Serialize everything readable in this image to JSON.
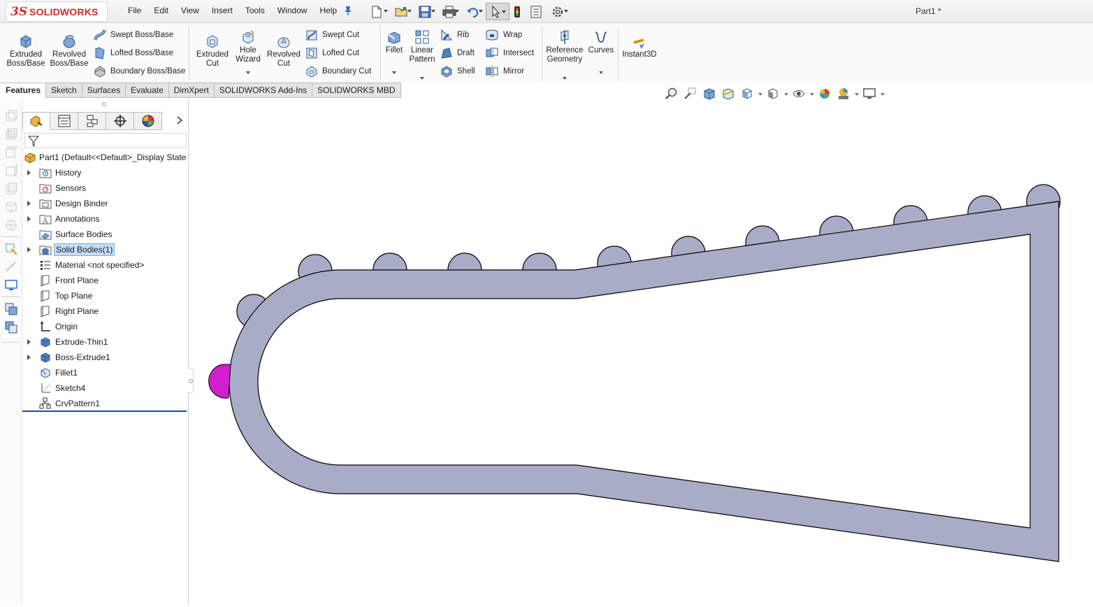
{
  "app": {
    "brand_prefix": "3S",
    "brand_name": "SOLIDWORKS",
    "document_title": "Part1 *"
  },
  "menubar": [
    "File",
    "Edit",
    "View",
    "Insert",
    "Tools",
    "Window",
    "Help"
  ],
  "quick_access": [
    "new-document",
    "open",
    "save",
    "print",
    "undo",
    "select",
    "rebuild",
    "file-properties",
    "options"
  ],
  "ribbon": {
    "extruded_boss": "Extruded\nBoss/Base",
    "revolved_boss": "Revolved\nBoss/Base",
    "swept_boss": "Swept Boss/Base",
    "lofted_boss": "Lofted Boss/Base",
    "boundary_boss": "Boundary Boss/Base",
    "extruded_cut": "Extruded\nCut",
    "hole_wizard": "Hole\nWizard",
    "revolved_cut": "Revolved\nCut",
    "swept_cut": "Swept Cut",
    "lofted_cut": "Lofted Cut",
    "boundary_cut": "Boundary Cut",
    "fillet": "Fillet",
    "linear_pattern": "Linear\nPattern",
    "rib": "Rib",
    "draft": "Draft",
    "shell": "Shell",
    "wrap": "Wrap",
    "intersect": "Intersect",
    "mirror": "Mirror",
    "reference_geometry": "Reference\nGeometry",
    "curves": "Curves",
    "instant3d": "Instant3D"
  },
  "tabs": [
    "Features",
    "Sketch",
    "Surfaces",
    "Evaluate",
    "DimXpert",
    "SOLIDWORKS Add-Ins",
    "SOLIDWORKS MBD"
  ],
  "active_tab": "Features",
  "feature_tree": {
    "root": "Part1  (Default<<Default>_Display State",
    "items": [
      {
        "label": "History",
        "expandable": true,
        "icon": "history-folder-icon"
      },
      {
        "label": "Sensors",
        "expandable": false,
        "icon": "sensors-folder-icon"
      },
      {
        "label": "Design Binder",
        "expandable": true,
        "icon": "design-binder-icon"
      },
      {
        "label": "Annotations",
        "expandable": true,
        "icon": "annotations-icon"
      },
      {
        "label": "Surface Bodies",
        "expandable": false,
        "icon": "surface-bodies-icon"
      },
      {
        "label": "Solid Bodies(1)",
        "expandable": true,
        "icon": "solid-bodies-icon",
        "selected": true
      },
      {
        "label": "Material <not specified>",
        "expandable": false,
        "icon": "material-icon"
      },
      {
        "label": "Front Plane",
        "expandable": false,
        "icon": "plane-icon"
      },
      {
        "label": "Top Plane",
        "expandable": false,
        "icon": "plane-icon"
      },
      {
        "label": "Right Plane",
        "expandable": false,
        "icon": "plane-icon"
      },
      {
        "label": "Origin",
        "expandable": false,
        "icon": "origin-icon"
      },
      {
        "label": "Extrude-Thin1",
        "expandable": true,
        "icon": "extrude-icon"
      },
      {
        "label": "Boss-Extrude1",
        "expandable": true,
        "icon": "extrude-icon"
      },
      {
        "label": "Fillet1",
        "expandable": false,
        "icon": "fillet-icon"
      },
      {
        "label": "Sketch4",
        "expandable": false,
        "icon": "sketch-icon"
      },
      {
        "label": "CrvPattern1",
        "expandable": false,
        "icon": "curve-pattern-icon"
      }
    ]
  },
  "colors": {
    "part_fill": "#a8acc6",
    "part_edge": "#000000",
    "highlight_body": "#d21ecf",
    "brand_red": "#d42a2a"
  }
}
